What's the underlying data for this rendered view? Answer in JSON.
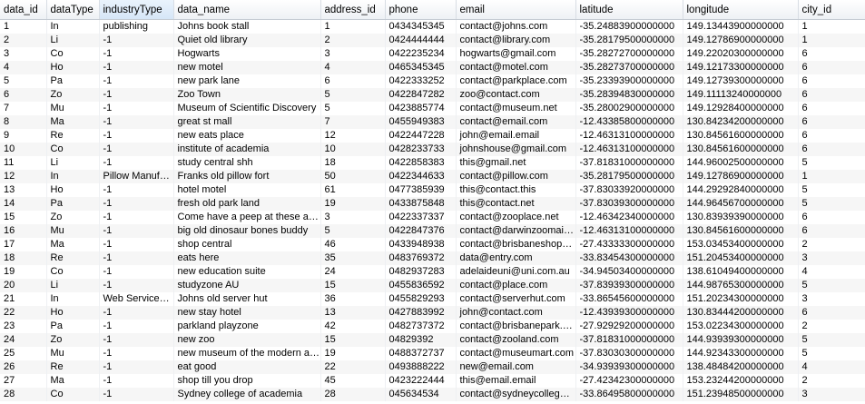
{
  "columns": [
    "data_id",
    "dataType",
    "industryType",
    "data_name",
    "address_id",
    "phone",
    "email",
    "latitude",
    "longitude",
    "city_id"
  ],
  "rows": [
    [
      "1",
      "In",
      "publishing",
      "Johns book stall",
      "1",
      "0434345345",
      "contact@johns.com",
      "-35.24883900000000",
      "149.13443900000000",
      "1"
    ],
    [
      "2",
      "Li",
      "-1",
      "Quiet old library",
      "2",
      "0424444444",
      "contact@library.com",
      "-35.28179500000000",
      "149.12786900000000",
      "1"
    ],
    [
      "3",
      "Co",
      "-1",
      "Hogwarts",
      "3",
      "0422235234",
      "hogwarts@gmail.com",
      "-35.28272700000000",
      "149.22020300000000",
      "6"
    ],
    [
      "4",
      "Ho",
      "-1",
      "new motel",
      "4",
      "0465345345",
      "contact@motel.com",
      "-35.28273700000000",
      "149.12173300000000",
      "6"
    ],
    [
      "5",
      "Pa",
      "-1",
      "new park lane",
      "6",
      "0422333252",
      "contact@parkplace.com",
      "-35.23393900000000",
      "149.12739300000000",
      "6"
    ],
    [
      "6",
      "Zo",
      "-1",
      "Zoo Town",
      "5",
      "0422847282",
      "zoo@contact.com",
      "-35.28394830000000",
      "149.11113240000000",
      "6"
    ],
    [
      "7",
      "Mu",
      "-1",
      "Museum of Scientific Discovery",
      "5",
      "0423885774",
      "contact@museum.net",
      "-35.28002900000000",
      "149.12928400000000",
      "6"
    ],
    [
      "8",
      "Ma",
      "-1",
      "great st mall",
      "7",
      "0455949383",
      "contact@email.com",
      "-12.43385800000000",
      "130.84234200000000",
      "6"
    ],
    [
      "9",
      "Re",
      "-1",
      "new eats place",
      "12",
      "0422447228",
      "john@email.email",
      "-12.46313100000000",
      "130.84561600000000",
      "6"
    ],
    [
      "10",
      "Co",
      "-1",
      "institute of academia",
      "10",
      "0428233733",
      "johnshouse@gmail.com",
      "-12.46313100000000",
      "130.84561600000000",
      "6"
    ],
    [
      "11",
      "Li",
      "-1",
      "study central shh",
      "18",
      "0422858383",
      "this@gmail.net",
      "-37.81831000000000",
      "144.96002500000000",
      "5"
    ],
    [
      "12",
      "In",
      "Pillow Manufacturing",
      "Franks old pillow fort",
      "50",
      "0422344633",
      "contact@pillow.com",
      "-35.28179500000000",
      "149.12786900000000",
      "1"
    ],
    [
      "13",
      "Ho",
      "-1",
      "hotel motel",
      "61",
      "0477385939",
      "this@contact.this",
      "-37.83033920000000",
      "144.29292840000000",
      "5"
    ],
    [
      "14",
      "Pa",
      "-1",
      "fresh old park land",
      "19",
      "0433875848",
      "this@contact.net",
      "-37.83039300000000",
      "144.96456700000000",
      "5"
    ],
    [
      "15",
      "Zo",
      "-1",
      "Come have a peep at these animals",
      "3",
      "0422337337",
      "contact@zooplace.net",
      "-12.46342340000000",
      "130.83939390000000",
      "6"
    ],
    [
      "16",
      "Mu",
      "-1",
      "big old dinosaur bones buddy",
      "5",
      "0422847376",
      "contact@darwinzoomail.com",
      "-12.46313100000000",
      "130.84561600000000",
      "6"
    ],
    [
      "17",
      "Ma",
      "-1",
      "shop central",
      "46",
      "0433948938",
      "contact@brisbaneshopping.com",
      "-27.43333300000000",
      "153.03453400000000",
      "2"
    ],
    [
      "18",
      "Re",
      "-1",
      "eats here",
      "35",
      "0483769372",
      "data@entry.com",
      "-33.83454300000000",
      "151.20453400000000",
      "3"
    ],
    [
      "19",
      "Co",
      "-1",
      "new education suite",
      "24",
      "0482937283",
      "adelaideuni@uni.com.au",
      "-34.94503400000000",
      "138.61049400000000",
      "4"
    ],
    [
      "20",
      "Li",
      "-1",
      "studyzone AU",
      "15",
      "0455836592",
      "contact@place.com",
      "-37.83939300000000",
      "144.98765300000000",
      "5"
    ],
    [
      "21",
      "In",
      "Web Services Inc",
      "Johns old server hut",
      "36",
      "0455829293",
      "contact@serverhut.com",
      "-33.86545600000000",
      "151.20234300000000",
      "3"
    ],
    [
      "22",
      "Ho",
      "-1",
      "new stay hotel",
      "13",
      "0427883992",
      "john@contact.com",
      "-12.43939300000000",
      "130.83444200000000",
      "6"
    ],
    [
      "23",
      "Pa",
      "-1",
      "parkland playzone",
      "42",
      "0482737372",
      "contact@brisbanepark.com",
      "-27.92929200000000",
      "153.02234300000000",
      "2"
    ],
    [
      "24",
      "Zo",
      "-1",
      "new zoo",
      "15",
      "04829392",
      "contact@zooland.com",
      "-37.81831000000000",
      "144.93939300000000",
      "5"
    ],
    [
      "25",
      "Mu",
      "-1",
      "new museum of the modern arts",
      "19",
      "0488372737",
      "contact@museumart.com",
      "-37.83030300000000",
      "144.92343300000000",
      "5"
    ],
    [
      "26",
      "Re",
      "-1",
      "eat good",
      "22",
      "0493888222",
      "new@email.com",
      "-34.93939300000000",
      "138.48484200000000",
      "4"
    ],
    [
      "27",
      "Ma",
      "-1",
      "shop till you drop",
      "45",
      "0423222444",
      "this@email.email",
      "-27.42342300000000",
      "153.23244200000000",
      "2"
    ],
    [
      "28",
      "Co",
      "-1",
      "Sydney college of academia",
      "28",
      "045634534",
      "contact@sydneycollege.com",
      "-33.86495800000000",
      "151.23948500000000",
      "3"
    ]
  ]
}
